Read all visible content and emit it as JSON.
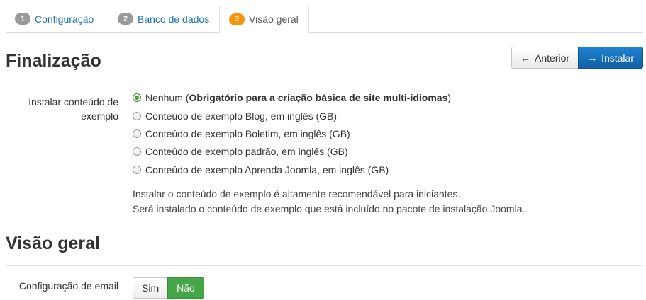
{
  "tabs": [
    {
      "number": "1",
      "label": "Configuração"
    },
    {
      "number": "2",
      "label": "Banco de dados"
    },
    {
      "number": "3",
      "label": "Visão geral"
    }
  ],
  "finalization": {
    "title": "Finalização",
    "prev_button": "Anterior",
    "install_button": "Instalar",
    "sample_label_line1": "Instalar conteúdo de",
    "sample_label_line2": "exemplo",
    "options": [
      {
        "label_prefix": "Nenhum (",
        "label_bold": "Obrigatório para a criação básica de site multi-idiomas",
        "label_suffix": ")",
        "checked": true
      },
      {
        "label": "Conteúdo de exemplo Blog, em inglês (GB)",
        "checked": false
      },
      {
        "label": "Conteúdo de exemplo Boletim, em inglês (GB)",
        "checked": false
      },
      {
        "label": "Conteúdo de exemplo padrão, em inglês (GB)",
        "checked": false
      },
      {
        "label": "Conteúdo de exemplo Aprenda Joomla, em inglês (GB)",
        "checked": false
      }
    ],
    "help_line1": "Instalar o conteúdo de exemplo é altamente recomendável para iniciantes.",
    "help_line2": "Será instalado o conteúdo de exemplo que está incluído no pacote de instalação Joomla."
  },
  "overview": {
    "title": "Visão geral",
    "email_label": "Configuração de email",
    "yes_label": "Sim",
    "no_label": "Não",
    "selected": "Não"
  },
  "colors": {
    "active_tab_badge": "#f89406",
    "primary": "#1a6fbd",
    "toggle_on": "#46a546"
  },
  "icons": {
    "prev": "arrow-left-icon",
    "install": "arrow-right-icon"
  }
}
